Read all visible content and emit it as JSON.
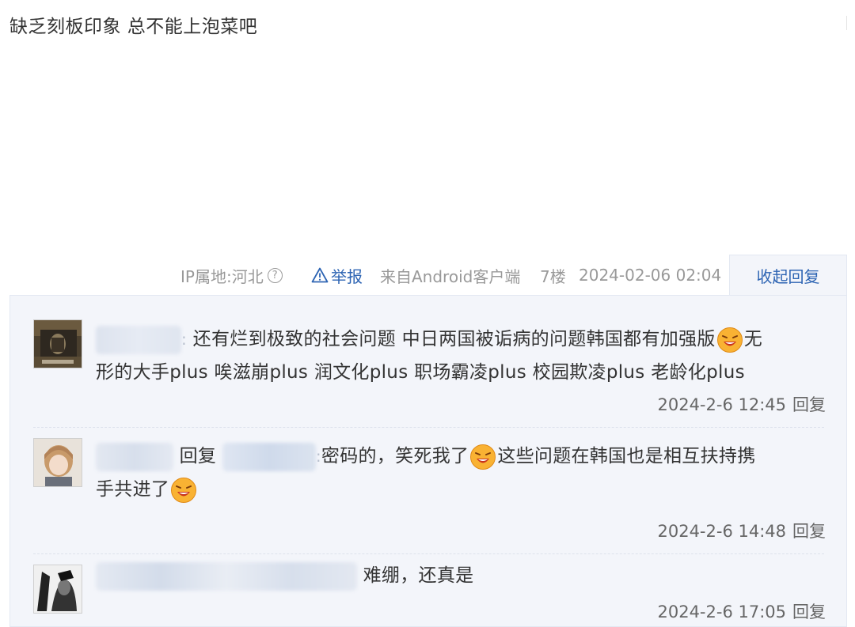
{
  "post": {
    "text": "缺乏刻板印象 总不能上泡菜吧"
  },
  "meta": {
    "ip": "IP属地:河北",
    "help_glyph": "?",
    "report": "举报",
    "client": "来自Android客户端",
    "floor": "7楼",
    "time": "2024-02-06 02:04",
    "collapse": "收起回复"
  },
  "replies": [
    {
      "user_tail": ":",
      "text_a": "还有烂到极致的社会问题 中日两国被诟病的问题韩国都有加强版",
      "text_b": "无",
      "text_c": "形的大手plus 唉滋崩plus 润文化plus 职场霸凌plus 校园欺凌plus 老龄化plus",
      "time": "2024-2-6 12:45",
      "reply_label": "回复"
    },
    {
      "reply_to": "回复",
      "target_tail": ":",
      "text_a": "密码的，笑死我了",
      "text_b": "这些问题在韩国也是相互扶持携",
      "text_c": "手共进了",
      "time": "2024-2-6 14:48",
      "reply_label": "回复"
    },
    {
      "text_a": "难绷，还真是",
      "time": "2024-2-6 17:05",
      "reply_label": "回复"
    }
  ],
  "colors": {
    "link": "#2d64b3",
    "meta": "#999999",
    "reply_bg": "#f3f5fa"
  },
  "icons": [
    "help-circle-icon",
    "warning-triangle-icon",
    "laughing-emoji-icon"
  ]
}
